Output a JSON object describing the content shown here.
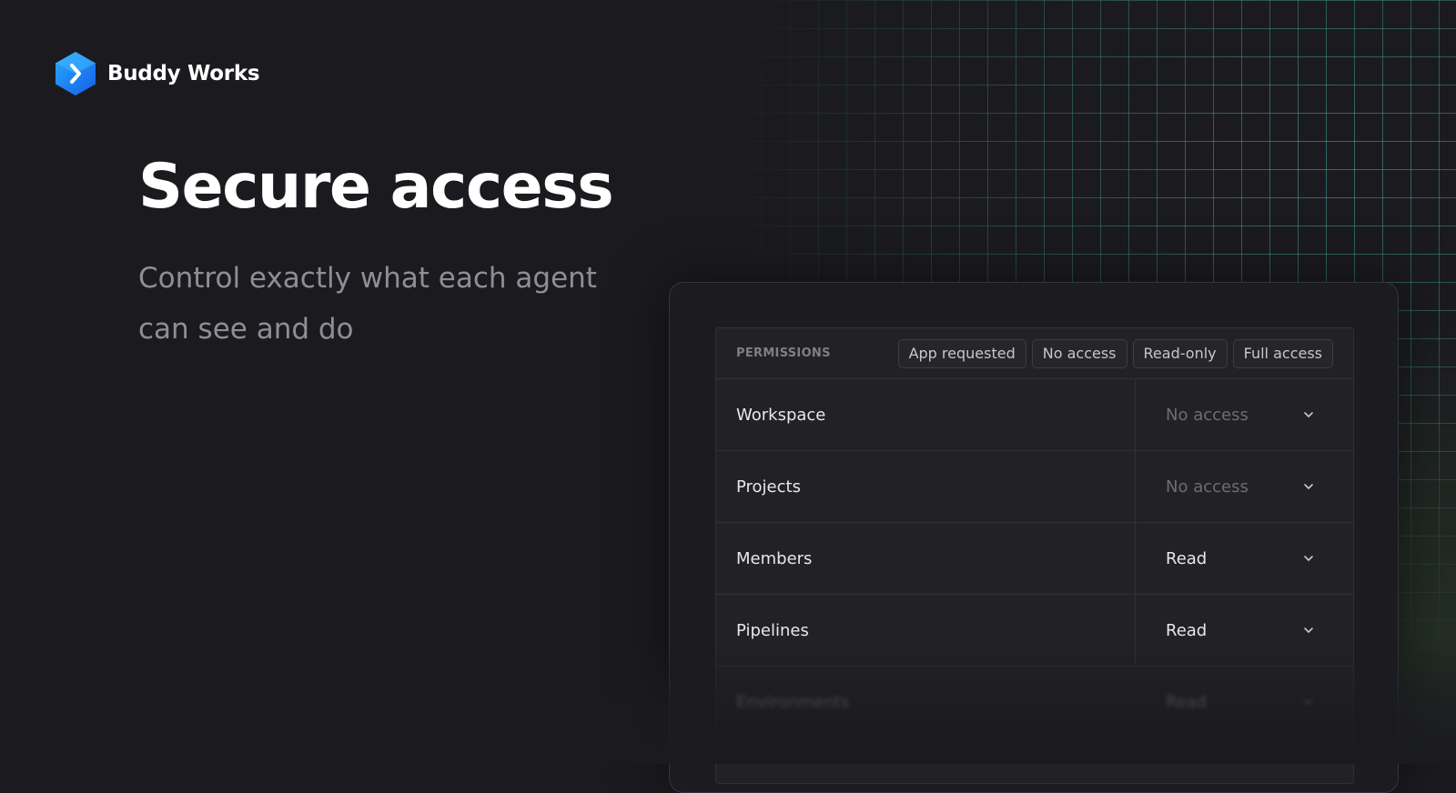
{
  "brand": {
    "name": "Buddy Works",
    "logo_icon": "buddy-logo-icon",
    "accent": "#1a8cff"
  },
  "hero": {
    "title": "Secure access",
    "subtitle": "Control exactly what each agent can see and do"
  },
  "permissions": {
    "label": "PERMISSIONS",
    "chips": [
      "App requested",
      "No access",
      "Read-only",
      "Full access"
    ],
    "rows": [
      {
        "name": "Workspace",
        "value": "No access",
        "muted": true
      },
      {
        "name": "Projects",
        "value": "No access",
        "muted": true
      },
      {
        "name": "Members",
        "value": "Read",
        "muted": false
      },
      {
        "name": "Pipelines",
        "value": "Read",
        "muted": false
      },
      {
        "name": "Environments",
        "value": "Read",
        "muted": false
      }
    ]
  },
  "colors": {
    "background": "#1b1b1f",
    "grid": "#50c8be",
    "muted_text": "#8e8e96"
  }
}
